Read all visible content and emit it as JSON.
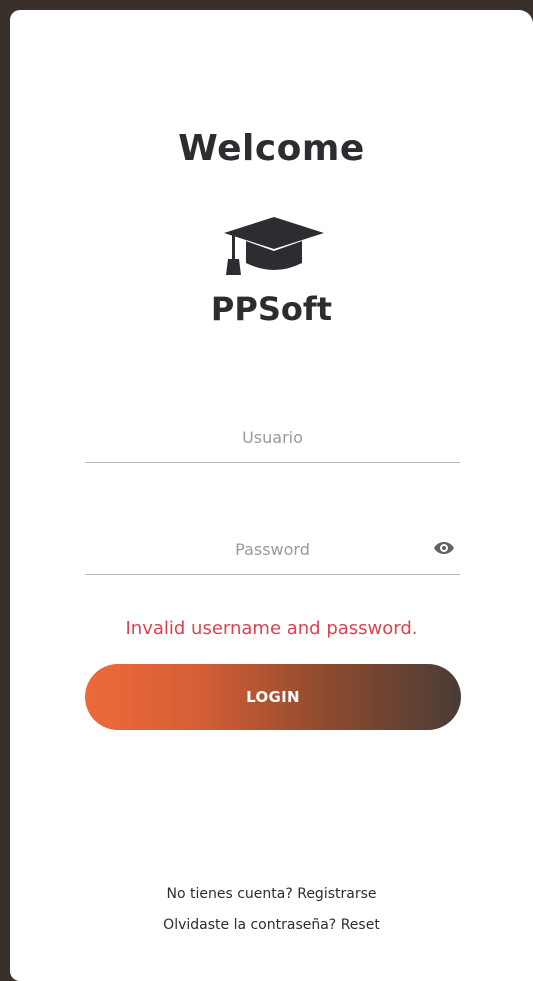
{
  "header": {
    "title": "Welcome"
  },
  "brand": {
    "name": "PPSoft",
    "icon": "graduation-cap-icon"
  },
  "form": {
    "username_placeholder": "Usuario",
    "username_value": "",
    "password_placeholder": "Password",
    "password_value": "",
    "error_message": "Invalid username and password.",
    "login_label": "LOGIN"
  },
  "footer": {
    "register_prompt": "No tienes cuenta?",
    "register_link": "Registrarse",
    "reset_prompt": "Olvidaste la contraseña?",
    "reset_link": "Reset"
  },
  "colors": {
    "error": "#e0404f",
    "button_start": "#ec6a3b",
    "button_end": "#4a3c36",
    "text_dark": "#2b2d31"
  }
}
